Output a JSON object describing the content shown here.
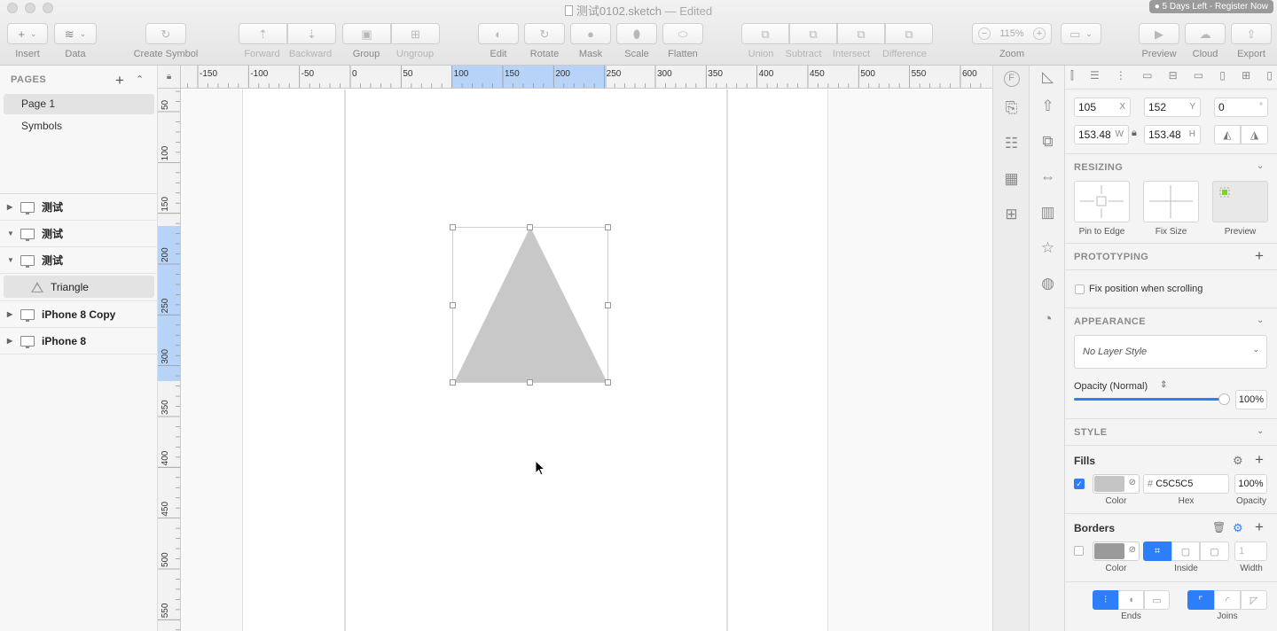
{
  "window": {
    "title": "测试0102.sketch",
    "edited": "— Edited",
    "trial_badge": "● 5 Days Left - Register Now"
  },
  "toolbar": {
    "insert": "Insert",
    "data": "Data",
    "create_symbol": "Create Symbol",
    "forward": "Forward",
    "backward": "Backward",
    "group": "Group",
    "ungroup": "Ungroup",
    "edit": "Edit",
    "rotate": "Rotate",
    "mask": "Mask",
    "scale": "Scale",
    "flatten": "Flatten",
    "union": "Union",
    "subtract": "Subtract",
    "intersect": "Intersect",
    "difference": "Difference",
    "zoom_label": "Zoom",
    "zoom_value": "115%",
    "zoom_minus": "−",
    "zoom_plus": "+",
    "preview": "Preview",
    "cloud": "Cloud",
    "export": "Export"
  },
  "pages": {
    "header": "PAGES",
    "add": "+",
    "items": [
      "Page 1",
      "Symbols"
    ]
  },
  "layers": [
    {
      "name": "测试",
      "expanded": false
    },
    {
      "name": "测试",
      "expanded": true
    },
    {
      "name": "测试",
      "expanded": true
    },
    {
      "name": "Triangle",
      "child": true
    },
    {
      "name": "iPhone 8 Copy",
      "expanded": false
    },
    {
      "name": "iPhone 8",
      "expanded": false
    }
  ],
  "ruler_top": [
    "-150",
    "-100",
    "-50",
    "0",
    "50",
    "100",
    "150",
    "200",
    "250",
    "300",
    "350",
    "400",
    "450",
    "500",
    "550",
    "600"
  ],
  "ruler_left": [
    "50",
    "100",
    "150",
    "200",
    "250",
    "300",
    "350",
    "400",
    "450",
    "500",
    "550"
  ],
  "inspector": {
    "x": "105",
    "x_lbl": "X",
    "y": "152",
    "y_lbl": "Y",
    "rotation": "0",
    "rotation_lbl": "°",
    "w": "153.48",
    "w_lbl": "W",
    "h": "153.48",
    "h_lbl": "H",
    "resizing": "RESIZING",
    "pin_to_edge": "Pin to Edge",
    "fix_size": "Fix Size",
    "preview": "Preview",
    "prototyping": "PROTOTYPING",
    "fix_position": "Fix position when scrolling",
    "appearance": "APPEARANCE",
    "layer_style": "No Layer Style",
    "opacity_label": "Opacity (Normal)",
    "opacity_value": "100%",
    "opacity_level": 1.0,
    "style": "STYLE",
    "fills": "Fills",
    "fill_hash": "#",
    "fill_hex": "C5C5C5",
    "fill_opacity": "100%",
    "fill_color": "#c5c5c5",
    "fill_enabled": true,
    "col_color": "Color",
    "col_hex": "Hex",
    "col_opacity": "Opacity",
    "borders": "Borders",
    "border_enabled": false,
    "border_width": "1",
    "border_col_color": "Color",
    "border_col_inside": "Inside",
    "border_col_width": "Width",
    "ends": "Ends",
    "joins": "Joins"
  },
  "colors": {
    "accent": "#2d7ff9",
    "selection_ruler": "#b7d3f7",
    "triangle": "#c8c8c8"
  }
}
